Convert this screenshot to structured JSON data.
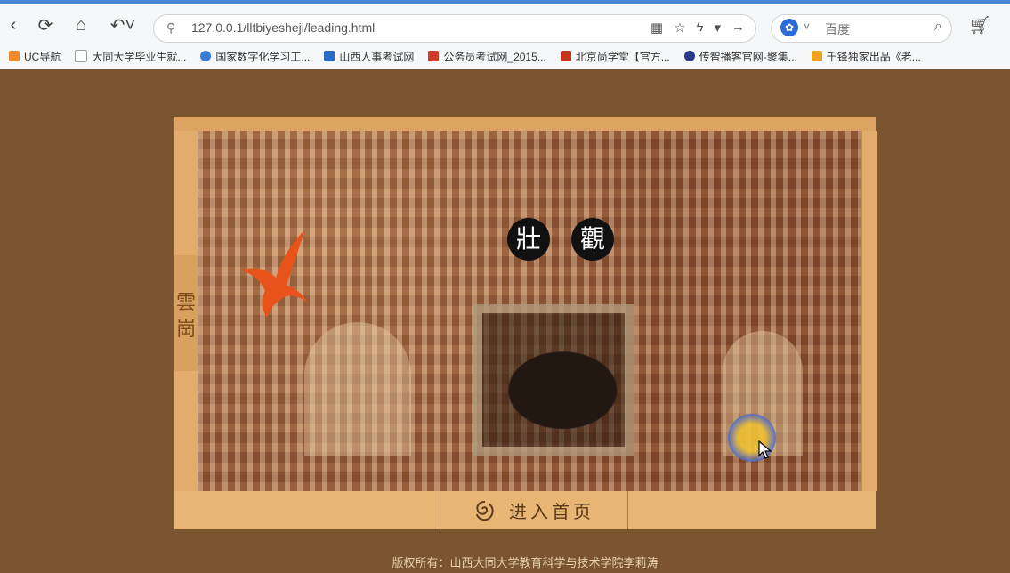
{
  "browser": {
    "url": "127.0.0.1/lltbiyesheji/leading.html",
    "search_placeholder": "百度",
    "bookmarks": [
      {
        "label": "UC导航",
        "color": "#f08a2a"
      },
      {
        "label": "大同大学毕业生就...",
        "color": "#9aa0a6"
      },
      {
        "label": "国家数字化学习工...",
        "color": "#3a7bd5"
      },
      {
        "label": "山西人事考试网",
        "color": "#2a6bc9"
      },
      {
        "label": "公务员考试网_2015...",
        "color": "#d23a2a"
      },
      {
        "label": "北京尚学堂【官方...",
        "color": "#c8321e"
      },
      {
        "label": "传智播客官网-聚集...",
        "color": "#2a3a8a"
      },
      {
        "label": "千锋独家出品《老...",
        "color": "#f0a21e"
      }
    ]
  },
  "page": {
    "side_label_1": "雲",
    "side_label_2": "崗",
    "title_char_1": "壯",
    "title_char_2": "觀",
    "enter_button": "进入首页",
    "copyright": "版权所有：山西大同大学教育科学与技术学院李莉涛"
  }
}
